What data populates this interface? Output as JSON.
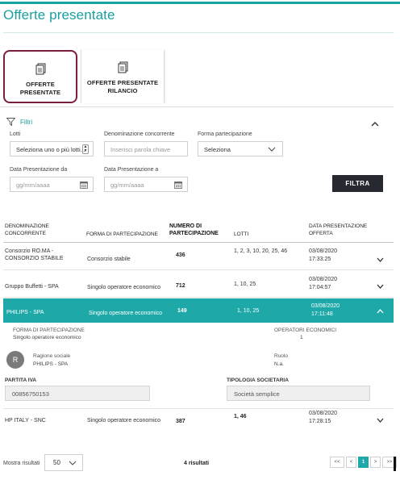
{
  "page_title": "Offerte presentate",
  "tabs": [
    {
      "label": "OFFERTE PRESENTATE",
      "active": true
    },
    {
      "label": "OFFERTE PRESENTATE RILANCIO",
      "active": false
    }
  ],
  "filters": {
    "title": "Filtri",
    "lotti_label": "Lotti",
    "lotti_value": "Seleziona uno o più lotti...",
    "denominazione_label": "Denominazione concorrente",
    "denominazione_placeholder": "Inserisci parola chiave",
    "forma_label": "Forma partecipazione",
    "forma_value": "Seleziona",
    "data_da_label": "Data Presentazione da",
    "data_da_placeholder": "gg/mm/aaaa",
    "data_a_label": "Data Presentazione a",
    "data_a_placeholder": "gg/mm/aaaa",
    "filtra_label": "FILTRA"
  },
  "table": {
    "headers": {
      "denominazione": "DENOMINAZIONE CONCORRENTE",
      "forma": "FORMA DI PARTECIPAZIONE",
      "numero": "NUMERO DI PARTECIPAZIONE",
      "lotti": "LOTTI",
      "data": "DATA PRESENTAZIONE OFFERTA"
    },
    "rows": [
      {
        "denominazione": "Consorzio RO.MA - CONSORZIO STABILE",
        "forma": "Consorzio stabile",
        "numero": "436",
        "lotti": "1, 2, 3, 10, 20, 25, 46",
        "data": "03/08/2020",
        "ora": "17:33:25"
      },
      {
        "denominazione": "Gruppo Buffetti - SPA",
        "forma": "Singolo operatore economico",
        "numero": "712",
        "lotti": "1, 10, 25",
        "data": "03/08/2020",
        "ora": "17:04:57"
      },
      {
        "denominazione": "PHILIPS - SPA",
        "forma": "Singolo operatore economico",
        "numero": "149",
        "lotti": "1, 10, 25",
        "data": "03/08/2020",
        "ora": "17:11:48"
      },
      {
        "denominazione": "HP ITALY - SNC",
        "forma": "Singolo operatore economico",
        "numero": "387",
        "lotti": "1, 46",
        "data": "03/08/2020",
        "ora": "17:28:15"
      }
    ]
  },
  "detail": {
    "forma_label": "FORMA DI PARTECIPAZIONE",
    "forma_value": "Singolo operatore economico",
    "operatori_label": "OPERATORI ECONOMICI",
    "operatori_value": "1",
    "avatar_initial": "R",
    "ragione_label": "Ragione sociale",
    "ragione_value": "PHILIPS - SPA",
    "ruolo_label": "Ruolo",
    "ruolo_value": "N.a.",
    "piva_label": "PARTITA IVA",
    "piva_value": "00856750153",
    "tipologia_label": "TIPOLOGIA SOCIETARIA",
    "tipologia_value": "Società semplice"
  },
  "footer": {
    "mostra_label": "Mostra risultati",
    "page_size": "50",
    "results_text": "4 risultati",
    "pager": {
      "first": "<<",
      "prev": "<",
      "current": "1",
      "next": ">",
      "last": ">>"
    }
  },
  "colors": {
    "accent": "#1fa8a8",
    "active_tab_border": "#7a1f3d",
    "button_dark": "#262a30"
  },
  "icons": [
    "document-stack-icon",
    "filter-funnel-icon",
    "chevron-up-icon",
    "chevron-down-icon",
    "calendar-icon",
    "spinner-arrows-icon"
  ]
}
